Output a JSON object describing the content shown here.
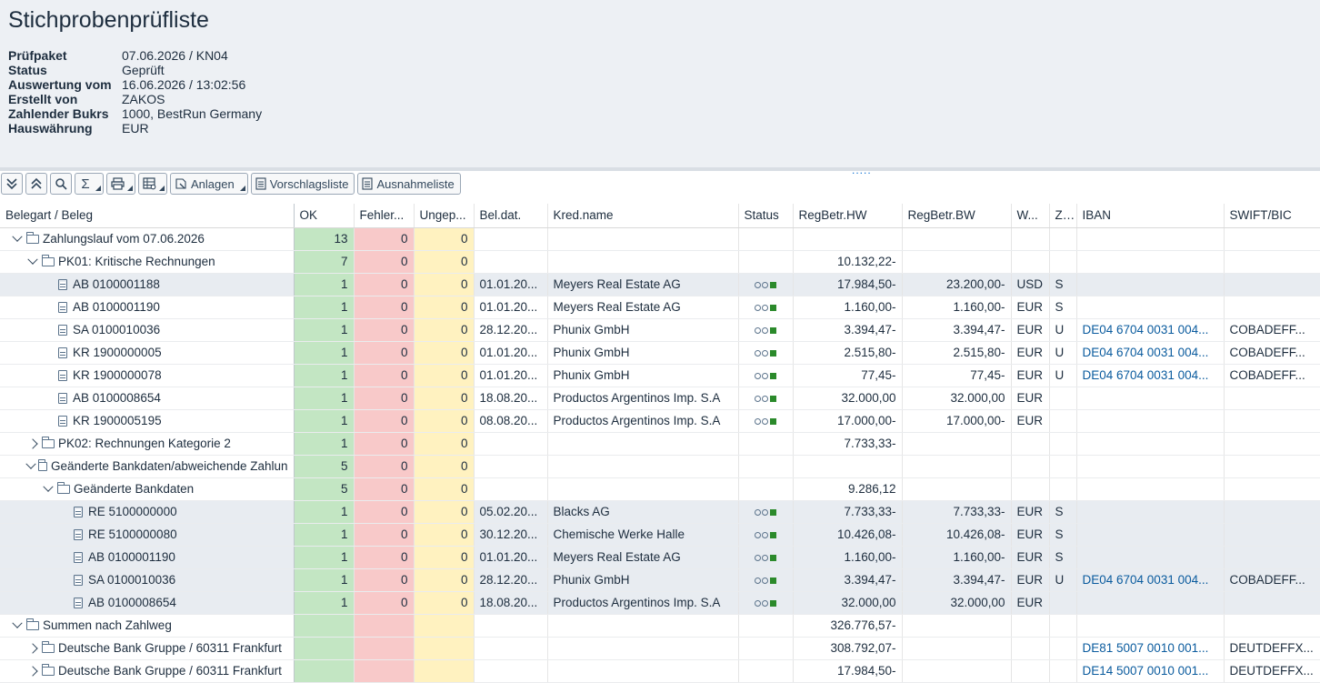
{
  "page": {
    "title": "Stichprobenprüfliste",
    "info": [
      {
        "label": "Prüfpaket",
        "value": "07.06.2026 / KN04"
      },
      {
        "label": "Status",
        "value": "Geprüft"
      },
      {
        "label": "Auswertung vom",
        "value": "16.06.2026 / 13:02:56"
      },
      {
        "label": "Erstellt von",
        "value": "ZAKOS"
      },
      {
        "label": "Zahlender Bukrs",
        "value": "1000, BestRun Germany"
      },
      {
        "label": "Hauswährung",
        "value": "EUR"
      }
    ],
    "splitter_handle": "....."
  },
  "toolbar": {
    "expand_all_icon": "double-chevron-down-icon",
    "collapse_all_icon": "double-chevron-up-icon",
    "find_icon": "search-icon",
    "sum_icon": "sigma-icon",
    "sum_glyph": "Σ",
    "print_icon": "print-icon",
    "layout_icon": "table-settings-icon",
    "anlagen_label": "Anlagen",
    "vorschlagsliste_label": "Vorschlagsliste",
    "ausnahmeliste_label": "Ausnahmeliste"
  },
  "grid": {
    "columns": [
      "Belegart / Beleg",
      "OK",
      "Fehler...",
      "Ungep...",
      "Bel.dat.",
      "Kred.name",
      "Status",
      "RegBetr.HW",
      "RegBetr.BW",
      "W...",
      "Z...",
      "IBAN",
      "SWIFT/BIC"
    ],
    "rows": [
      {
        "level": 0,
        "expander": "open",
        "icon": "folder-open",
        "label": "Zahlungslauf vom 07.06.2026",
        "ok": "13",
        "err": "0",
        "ung": "0",
        "date": "",
        "kred": "",
        "status": false,
        "hw": "",
        "bw": "",
        "w": "",
        "z": "",
        "iban": "",
        "swift": "",
        "sel": false
      },
      {
        "level": 1,
        "expander": "open",
        "icon": "folder-open",
        "label": "PK01: Kritische Rechnungen",
        "ok": "7",
        "err": "0",
        "ung": "0",
        "date": "",
        "kred": "",
        "status": false,
        "hw": "10.132,22-",
        "bw": "",
        "w": "",
        "z": "",
        "iban": "",
        "swift": "",
        "sel": false
      },
      {
        "level": 2,
        "expander": "",
        "icon": "doc",
        "label": "AB 0100001188",
        "ok": "1",
        "err": "0",
        "ung": "0",
        "date": "01.01.20...",
        "kred": "Meyers Real Estate AG",
        "status": true,
        "hw": "17.984,50-",
        "bw": "23.200,00-",
        "w": "USD",
        "z": "S",
        "iban": "",
        "swift": "",
        "sel": true
      },
      {
        "level": 2,
        "expander": "",
        "icon": "doc",
        "label": "AB 0100001190",
        "ok": "1",
        "err": "0",
        "ung": "0",
        "date": "01.01.20...",
        "kred": "Meyers Real Estate AG",
        "status": true,
        "hw": "1.160,00-",
        "bw": "1.160,00-",
        "w": "EUR",
        "z": "S",
        "iban": "",
        "swift": "",
        "sel": false
      },
      {
        "level": 2,
        "expander": "",
        "icon": "doc",
        "label": "SA 0100010036",
        "ok": "1",
        "err": "0",
        "ung": "0",
        "date": "28.12.20...",
        "kred": "Phunix GmbH",
        "status": true,
        "hw": "3.394,47-",
        "bw": "3.394,47-",
        "w": "EUR",
        "z": "U",
        "iban": "DE04 6704 0031 004...",
        "swift": "COBADEFF...",
        "sel": false
      },
      {
        "level": 2,
        "expander": "",
        "icon": "doc",
        "label": "KR 1900000005",
        "ok": "1",
        "err": "0",
        "ung": "0",
        "date": "01.01.20...",
        "kred": "Phunix GmbH",
        "status": true,
        "hw": "2.515,80-",
        "bw": "2.515,80-",
        "w": "EUR",
        "z": "U",
        "iban": "DE04 6704 0031 004...",
        "swift": "COBADEFF...",
        "sel": false
      },
      {
        "level": 2,
        "expander": "",
        "icon": "doc",
        "label": "KR 1900000078",
        "ok": "1",
        "err": "0",
        "ung": "0",
        "date": "01.01.20...",
        "kred": "Phunix GmbH",
        "status": true,
        "hw": "77,45-",
        "bw": "77,45-",
        "w": "EUR",
        "z": "U",
        "iban": "DE04 6704 0031 004...",
        "swift": "COBADEFF...",
        "sel": false
      },
      {
        "level": 2,
        "expander": "",
        "icon": "doc",
        "label": "AB 0100008654",
        "ok": "1",
        "err": "0",
        "ung": "0",
        "date": "18.08.20...",
        "kred": "Productos Argentinos Imp. S.A",
        "status": true,
        "hw": "32.000,00",
        "bw": "32.000,00",
        "w": "EUR",
        "z": "",
        "iban": "",
        "swift": "",
        "sel": false
      },
      {
        "level": 2,
        "expander": "",
        "icon": "doc",
        "label": "KR 1900005195",
        "ok": "1",
        "err": "0",
        "ung": "0",
        "date": "08.08.20...",
        "kred": "Productos Argentinos Imp. S.A",
        "status": true,
        "hw": "17.000,00-",
        "bw": "17.000,00-",
        "w": "EUR",
        "z": "",
        "iban": "",
        "swift": "",
        "sel": false
      },
      {
        "level": 1,
        "expander": "closed",
        "icon": "folder",
        "label": "PK02: Rechnungen Kategorie 2",
        "ok": "1",
        "err": "0",
        "ung": "0",
        "date": "",
        "kred": "",
        "status": false,
        "hw": "7.733,33-",
        "bw": "",
        "w": "",
        "z": "",
        "iban": "",
        "swift": "",
        "sel": false
      },
      {
        "level": 1,
        "expander": "open",
        "icon": "folder-open",
        "label": "Geänderte Bankdaten/abweichende Zahlun",
        "ok": "5",
        "err": "0",
        "ung": "0",
        "date": "",
        "kred": "",
        "status": false,
        "hw": "",
        "bw": "",
        "w": "",
        "z": "",
        "iban": "",
        "swift": "",
        "sel": false
      },
      {
        "level": 2,
        "expander": "open",
        "icon": "folder-open",
        "label": "Geänderte Bankdaten",
        "ok": "5",
        "err": "0",
        "ung": "0",
        "date": "",
        "kred": "",
        "status": false,
        "hw": "9.286,12",
        "bw": "",
        "w": "",
        "z": "",
        "iban": "",
        "swift": "",
        "sel": false
      },
      {
        "level": 3,
        "expander": "",
        "icon": "doc",
        "label": "RE 5100000000",
        "ok": "1",
        "err": "0",
        "ung": "0",
        "date": "05.02.20...",
        "kred": "Blacks AG",
        "status": true,
        "hw": "7.733,33-",
        "bw": "7.733,33-",
        "w": "EUR",
        "z": "S",
        "iban": "",
        "swift": "",
        "sel": true
      },
      {
        "level": 3,
        "expander": "",
        "icon": "doc",
        "label": "RE 5100000080",
        "ok": "1",
        "err": "0",
        "ung": "0",
        "date": "30.12.20...",
        "kred": "Chemische Werke Halle",
        "status": true,
        "hw": "10.426,08-",
        "bw": "10.426,08-",
        "w": "EUR",
        "z": "S",
        "iban": "",
        "swift": "",
        "sel": true
      },
      {
        "level": 3,
        "expander": "",
        "icon": "doc",
        "label": "AB 0100001190",
        "ok": "1",
        "err": "0",
        "ung": "0",
        "date": "01.01.20...",
        "kred": "Meyers Real Estate AG",
        "status": true,
        "hw": "1.160,00-",
        "bw": "1.160,00-",
        "w": "EUR",
        "z": "S",
        "iban": "",
        "swift": "",
        "sel": true
      },
      {
        "level": 3,
        "expander": "",
        "icon": "doc",
        "label": "SA 0100010036",
        "ok": "1",
        "err": "0",
        "ung": "0",
        "date": "28.12.20...",
        "kred": "Phunix GmbH",
        "status": true,
        "hw": "3.394,47-",
        "bw": "3.394,47-",
        "w": "EUR",
        "z": "U",
        "iban": "DE04 6704 0031 004...",
        "swift": "COBADEFF...",
        "sel": true
      },
      {
        "level": 3,
        "expander": "",
        "icon": "doc",
        "label": "AB 0100008654",
        "ok": "1",
        "err": "0",
        "ung": "0",
        "date": "18.08.20...",
        "kred": "Productos Argentinos Imp. S.A",
        "status": true,
        "hw": "32.000,00",
        "bw": "32.000,00",
        "w": "EUR",
        "z": "",
        "iban": "",
        "swift": "",
        "sel": true
      },
      {
        "level": 0,
        "expander": "open",
        "icon": "folder-open",
        "label": "Summen nach Zahlweg",
        "ok": "",
        "err": "",
        "ung": "",
        "date": "",
        "kred": "",
        "status": false,
        "hw": "326.776,57-",
        "bw": "",
        "w": "",
        "z": "",
        "iban": "",
        "swift": "",
        "sel": false
      },
      {
        "level": 1,
        "expander": "closed",
        "icon": "folder",
        "label": "Deutsche Bank Gruppe / 60311 Frankfurt",
        "ok": "",
        "err": "",
        "ung": "",
        "date": "",
        "kred": "",
        "status": false,
        "hw": "308.792,07-",
        "bw": "",
        "w": "",
        "z": "",
        "iban": "DE81 5007 0010 001...",
        "swift": "DEUTDEFFX...",
        "sel": false
      },
      {
        "level": 1,
        "expander": "closed",
        "icon": "folder",
        "label": "Deutsche Bank Gruppe / 60311 Frankfurt",
        "ok": "",
        "err": "",
        "ung": "",
        "date": "",
        "kred": "",
        "status": false,
        "hw": "17.984,50-",
        "bw": "",
        "w": "",
        "z": "",
        "iban": "DE14 5007 0010 001...",
        "swift": "DEUTDEFFX...",
        "sel": false
      }
    ]
  }
}
